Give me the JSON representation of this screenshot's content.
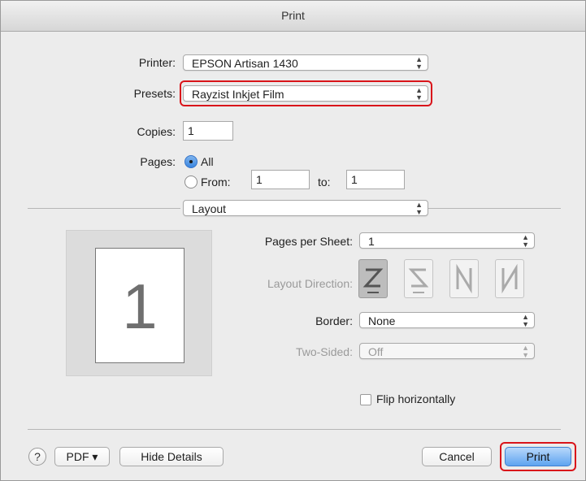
{
  "window": {
    "title": "Print"
  },
  "printer": {
    "label": "Printer:",
    "value": "EPSON Artisan 1430"
  },
  "presets": {
    "label": "Presets:",
    "value": "Rayzist Inkjet Film"
  },
  "copies": {
    "label": "Copies:",
    "value": "1"
  },
  "pages": {
    "label": "Pages:",
    "all_label": "All",
    "from_label": "From:",
    "from_value": "1",
    "to_label": "to:",
    "to_value": "1",
    "selected": "All"
  },
  "section": {
    "value": "Layout"
  },
  "preview": {
    "page_number": "1"
  },
  "layout": {
    "pages_per_sheet_label": "Pages per Sheet:",
    "pages_per_sheet_value": "1",
    "direction_label": "Layout Direction:",
    "border_label": "Border:",
    "border_value": "None",
    "two_sided_label": "Two-Sided:",
    "two_sided_value": "Off",
    "flip_label": "Flip horizontally"
  },
  "footer": {
    "help": "?",
    "pdf": "PDF ▾",
    "hide_details": "Hide Details",
    "cancel": "Cancel",
    "print": "Print"
  },
  "colors": {
    "highlight": "#d9141a",
    "default_button": "#5ea4f0"
  }
}
